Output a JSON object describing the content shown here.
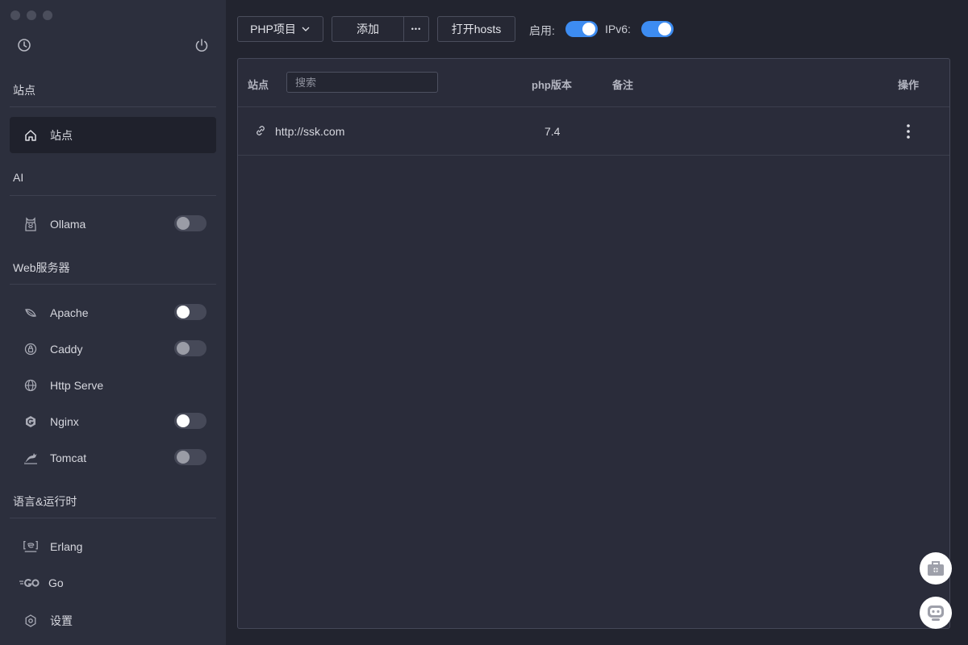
{
  "sidebar": {
    "sections": {
      "sites": "站点",
      "ai": "AI",
      "web": "Web服务器",
      "lang": "语言&运行时"
    },
    "items": {
      "sites": "站点",
      "ollama": "Ollama",
      "apache": "Apache",
      "caddy": "Caddy",
      "http_serve": "Http Serve",
      "nginx": "Nginx",
      "tomcat": "Tomcat",
      "erlang": "Erlang",
      "go": "Go",
      "settings": "设置"
    }
  },
  "toolbar": {
    "project_select": "PHP项目",
    "add_label": "添加",
    "more_label": "•••",
    "hosts_label": "打开hosts",
    "enable_label": "启用:",
    "ipv6_label": "IPv6:"
  },
  "table": {
    "headers": {
      "site": "站点",
      "php": "php版本",
      "note": "备注",
      "action": "操作"
    },
    "search_placeholder": "搜索",
    "rows": [
      {
        "url": "http://ssk.com",
        "php": "7.4",
        "note": ""
      }
    ]
  },
  "colors": {
    "accent": "#3d8cf1",
    "background": "#22242f",
    "sidebar": "#2c2f3d"
  }
}
